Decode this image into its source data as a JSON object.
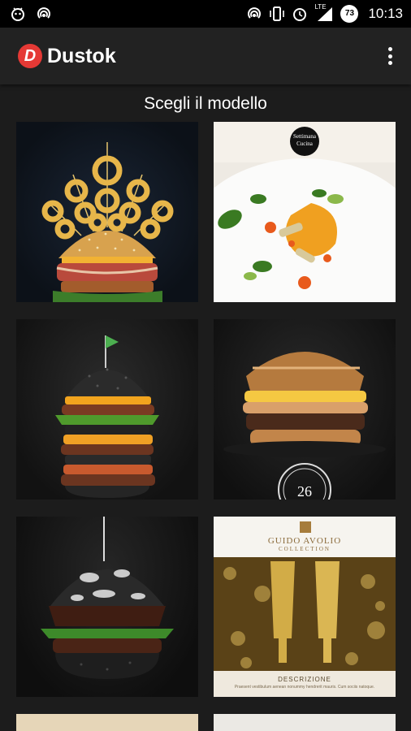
{
  "status_bar": {
    "time": "10:13",
    "battery_level": "73",
    "network_label": "LTE",
    "left_icons": [
      "android-debug-icon",
      "wifi-hotspot-icon"
    ],
    "right_icons": [
      "hotspot-icon",
      "vibrate-icon",
      "alarm-icon",
      "signal-icon",
      "battery-icon"
    ]
  },
  "app_bar": {
    "logo_letter": "D",
    "title": "Dustok",
    "overflow_icon": "more-vert-icon"
  },
  "main": {
    "heading": "Scegli il modello",
    "templates": [
      {
        "id": "template-burger-onion-rings",
        "caption": ""
      },
      {
        "id": "template-plated-dish",
        "caption": "Settimana Cucina"
      },
      {
        "id": "template-black-tower-burger",
        "caption": ""
      },
      {
        "id": "template-classic-burger",
        "caption": "26"
      },
      {
        "id": "template-chocolate-burger",
        "caption": ""
      },
      {
        "id": "template-champagne",
        "caption": "GUIDO AVOLIO",
        "subcaption": "COLLECTION",
        "footer_title": "DESCRIZIONE",
        "footer_text": "Praesent vestibulum aenean nonummy hendrerit mauris. Cum sociis natoque."
      }
    ]
  },
  "colors": {
    "background": "#1c1c1c",
    "app_bar": "#222222",
    "accent": "#e53935"
  }
}
